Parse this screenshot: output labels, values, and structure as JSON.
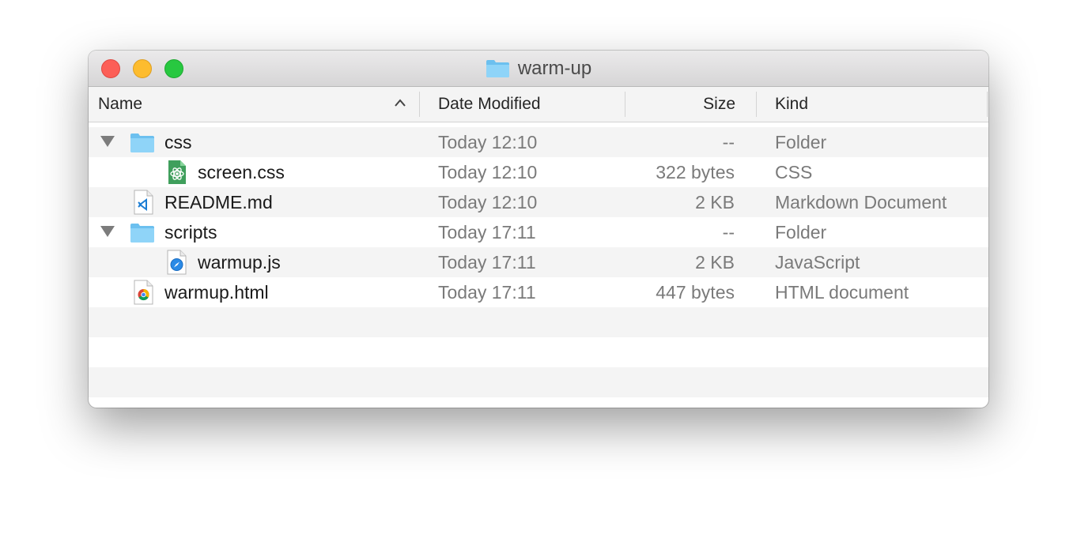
{
  "window": {
    "title": "warm-up",
    "title_icon": "folder-icon"
  },
  "columns": {
    "name": "Name",
    "date": "Date Modified",
    "size": "Size",
    "kind": "Kind",
    "sort_indicator": "^"
  },
  "files": [
    {
      "name": "css",
      "date": "Today 12:10",
      "size": "--",
      "kind": "Folder",
      "icon": "folder-icon",
      "expanded": true,
      "depth": 0
    },
    {
      "name": "screen.css",
      "date": "Today 12:10",
      "size": "322 bytes",
      "kind": "CSS",
      "icon": "atom-css-icon",
      "depth": 1
    },
    {
      "name": "README.md",
      "date": "Today 12:10",
      "size": "2 KB",
      "kind": "Markdown Document",
      "icon": "vscode-document-icon",
      "depth": 0
    },
    {
      "name": "scripts",
      "date": "Today 17:11",
      "size": "--",
      "kind": "Folder",
      "icon": "folder-icon",
      "expanded": true,
      "depth": 0
    },
    {
      "name": "warmup.js",
      "date": "Today 17:11",
      "size": "2 KB",
      "kind": "JavaScript",
      "icon": "safari-document-icon",
      "depth": 1
    },
    {
      "name": "warmup.html",
      "date": "Today 17:11",
      "size": "447 bytes",
      "kind": "HTML document",
      "icon": "chrome-document-icon",
      "depth": 0
    }
  ],
  "colors": {
    "close": "#fc5f57",
    "minimize": "#fdbc2e",
    "maximize": "#28c840",
    "folder": "#7ccaf3",
    "stripe": "#f4f4f4"
  }
}
